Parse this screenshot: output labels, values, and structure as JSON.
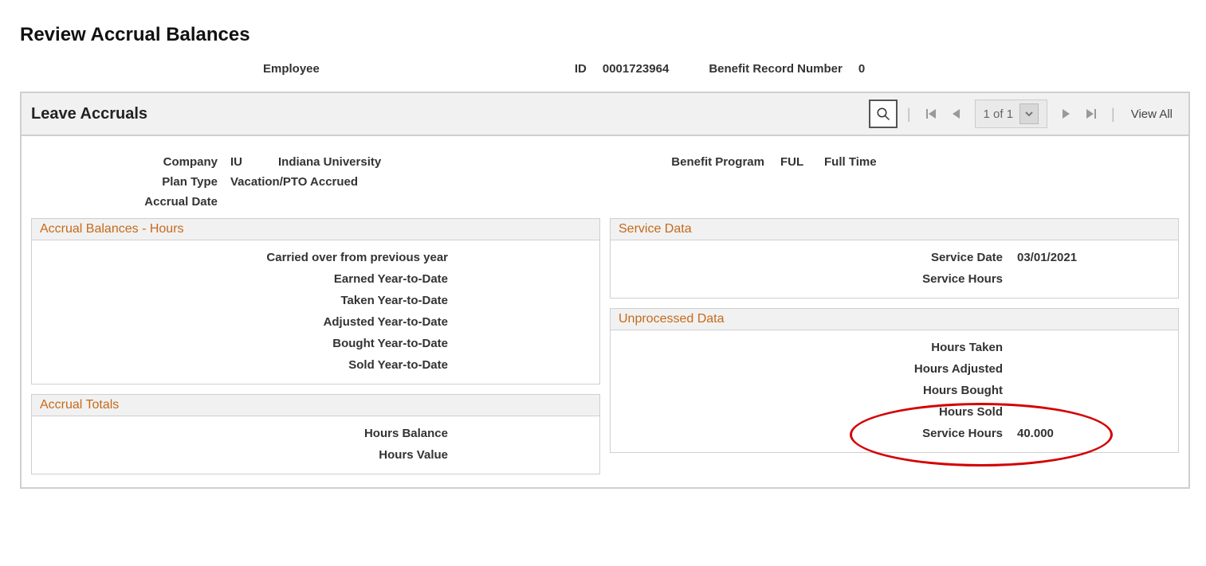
{
  "page": {
    "title": "Review Accrual Balances"
  },
  "header": {
    "employee_label": "Employee",
    "id_label": "ID",
    "id_value": "0001723964",
    "brn_label": "Benefit Record Number",
    "brn_value": "0"
  },
  "panel": {
    "title": "Leave Accruals",
    "page_indicator": "1 of 1",
    "view_all": "View All"
  },
  "summary": {
    "company_label": "Company",
    "company_code": "IU",
    "company_name": "Indiana University",
    "benefit_program_label": "Benefit Program",
    "benefit_program_code": "FUL",
    "benefit_program_name": "Full Time",
    "plan_type_label": "Plan Type",
    "plan_type_value": "Vacation/PTO Accrued",
    "accrual_date_label": "Accrual Date",
    "accrual_date_value": ""
  },
  "groups": {
    "accrual_balances": {
      "title": "Accrual Balances - Hours",
      "rows": {
        "carried_over": {
          "label": "Carried over from previous year",
          "value": ""
        },
        "earned_ytd": {
          "label": "Earned Year-to-Date",
          "value": ""
        },
        "taken_ytd": {
          "label": "Taken Year-to-Date",
          "value": ""
        },
        "adjusted_ytd": {
          "label": "Adjusted Year-to-Date",
          "value": ""
        },
        "bought_ytd": {
          "label": "Bought Year-to-Date",
          "value": ""
        },
        "sold_ytd": {
          "label": "Sold Year-to-Date",
          "value": ""
        }
      }
    },
    "accrual_totals": {
      "title": "Accrual Totals",
      "rows": {
        "hours_balance": {
          "label": "Hours Balance",
          "value": ""
        },
        "hours_value": {
          "label": "Hours Value",
          "value": ""
        }
      }
    },
    "service_data": {
      "title": "Service Data",
      "rows": {
        "service_date": {
          "label": "Service Date",
          "value": "03/01/2021"
        },
        "service_hours": {
          "label": "Service Hours",
          "value": ""
        }
      }
    },
    "unprocessed_data": {
      "title": "Unprocessed Data",
      "rows": {
        "hours_taken": {
          "label": "Hours Taken",
          "value": ""
        },
        "hours_adjusted": {
          "label": "Hours Adjusted",
          "value": ""
        },
        "hours_bought": {
          "label": "Hours Bought",
          "value": ""
        },
        "hours_sold": {
          "label": "Hours Sold",
          "value": ""
        },
        "service_hours": {
          "label": "Service Hours",
          "value": "40.000"
        }
      }
    }
  }
}
